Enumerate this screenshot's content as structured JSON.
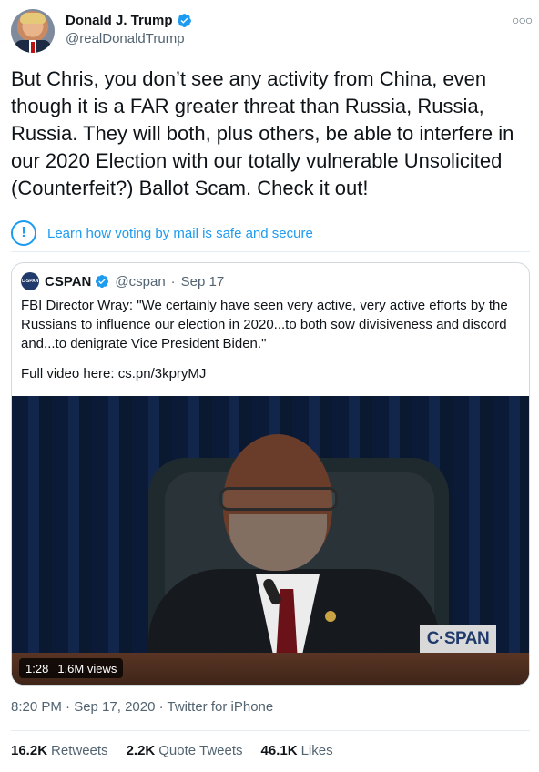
{
  "author": {
    "display_name": "Donald J. Trump",
    "handle": "@realDonaldTrump",
    "verified": true,
    "more_icon": "more-horizontal-icon"
  },
  "tweet": {
    "text": "But Chris, you don’t see any activity from China, even though it is a FAR greater threat than Russia, Russia, Russia. They will both, plus others, be able to interfere in our 2020 Election with our totally vulnerable Unsolicited (Counterfeit?) Ballot Scam. Check it out!"
  },
  "notice": {
    "icon": "!",
    "text": "Learn how voting by mail is safe and secure"
  },
  "quoted": {
    "avatar_text": "C-SPAN",
    "name": "CSPAN",
    "handle": "@cspan",
    "separator": "·",
    "date": "Sep 17",
    "text": "FBI Director Wray: \"We certainly have seen very active, very active efforts by the Russians to influence our election in 2020...to both sow divisiveness and discord and...to denigrate Vice President Biden.\"",
    "link_line": "Full video here: cs.pn/3kpryMJ",
    "video": {
      "duration": "1:28",
      "views": "1.6M views",
      "watermark": "C·SPAN"
    }
  },
  "meta": {
    "timestamp": "8:20 PM · Sep 17, 2020 · Twitter for iPhone"
  },
  "stats": [
    {
      "number": "16.2K",
      "label": "Retweets"
    },
    {
      "number": "2.2K",
      "label": "Quote Tweets"
    },
    {
      "number": "46.1K",
      "label": "Likes"
    }
  ],
  "colors": {
    "accent": "#1d9bf0",
    "secondary_text": "#536471",
    "border": "#cfd9de"
  }
}
